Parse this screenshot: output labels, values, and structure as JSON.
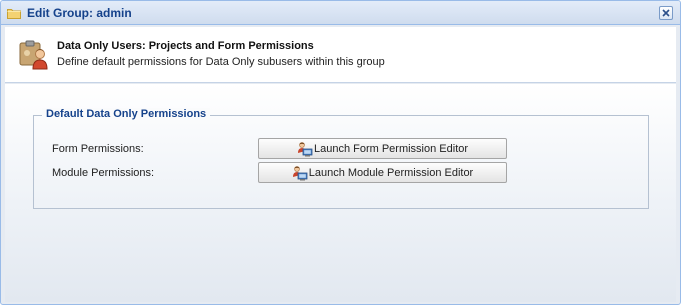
{
  "window": {
    "title": "Edit Group: admin",
    "close_icon": "close-icon"
  },
  "header": {
    "icon": "users-permissions-icon",
    "title": "Data Only Users: Projects and Form Permissions",
    "description": "Define default permissions for Data Only subusers within this group"
  },
  "permissions": {
    "legend": "Default Data Only Permissions",
    "form_label": "Form Permissions:",
    "form_button": "Launch Form Permission Editor",
    "module_label": "Module Permissions:",
    "module_button": "Launch Module Permission Editor"
  },
  "colors": {
    "title_text": "#15428b",
    "window_border": "#99bbe8"
  }
}
